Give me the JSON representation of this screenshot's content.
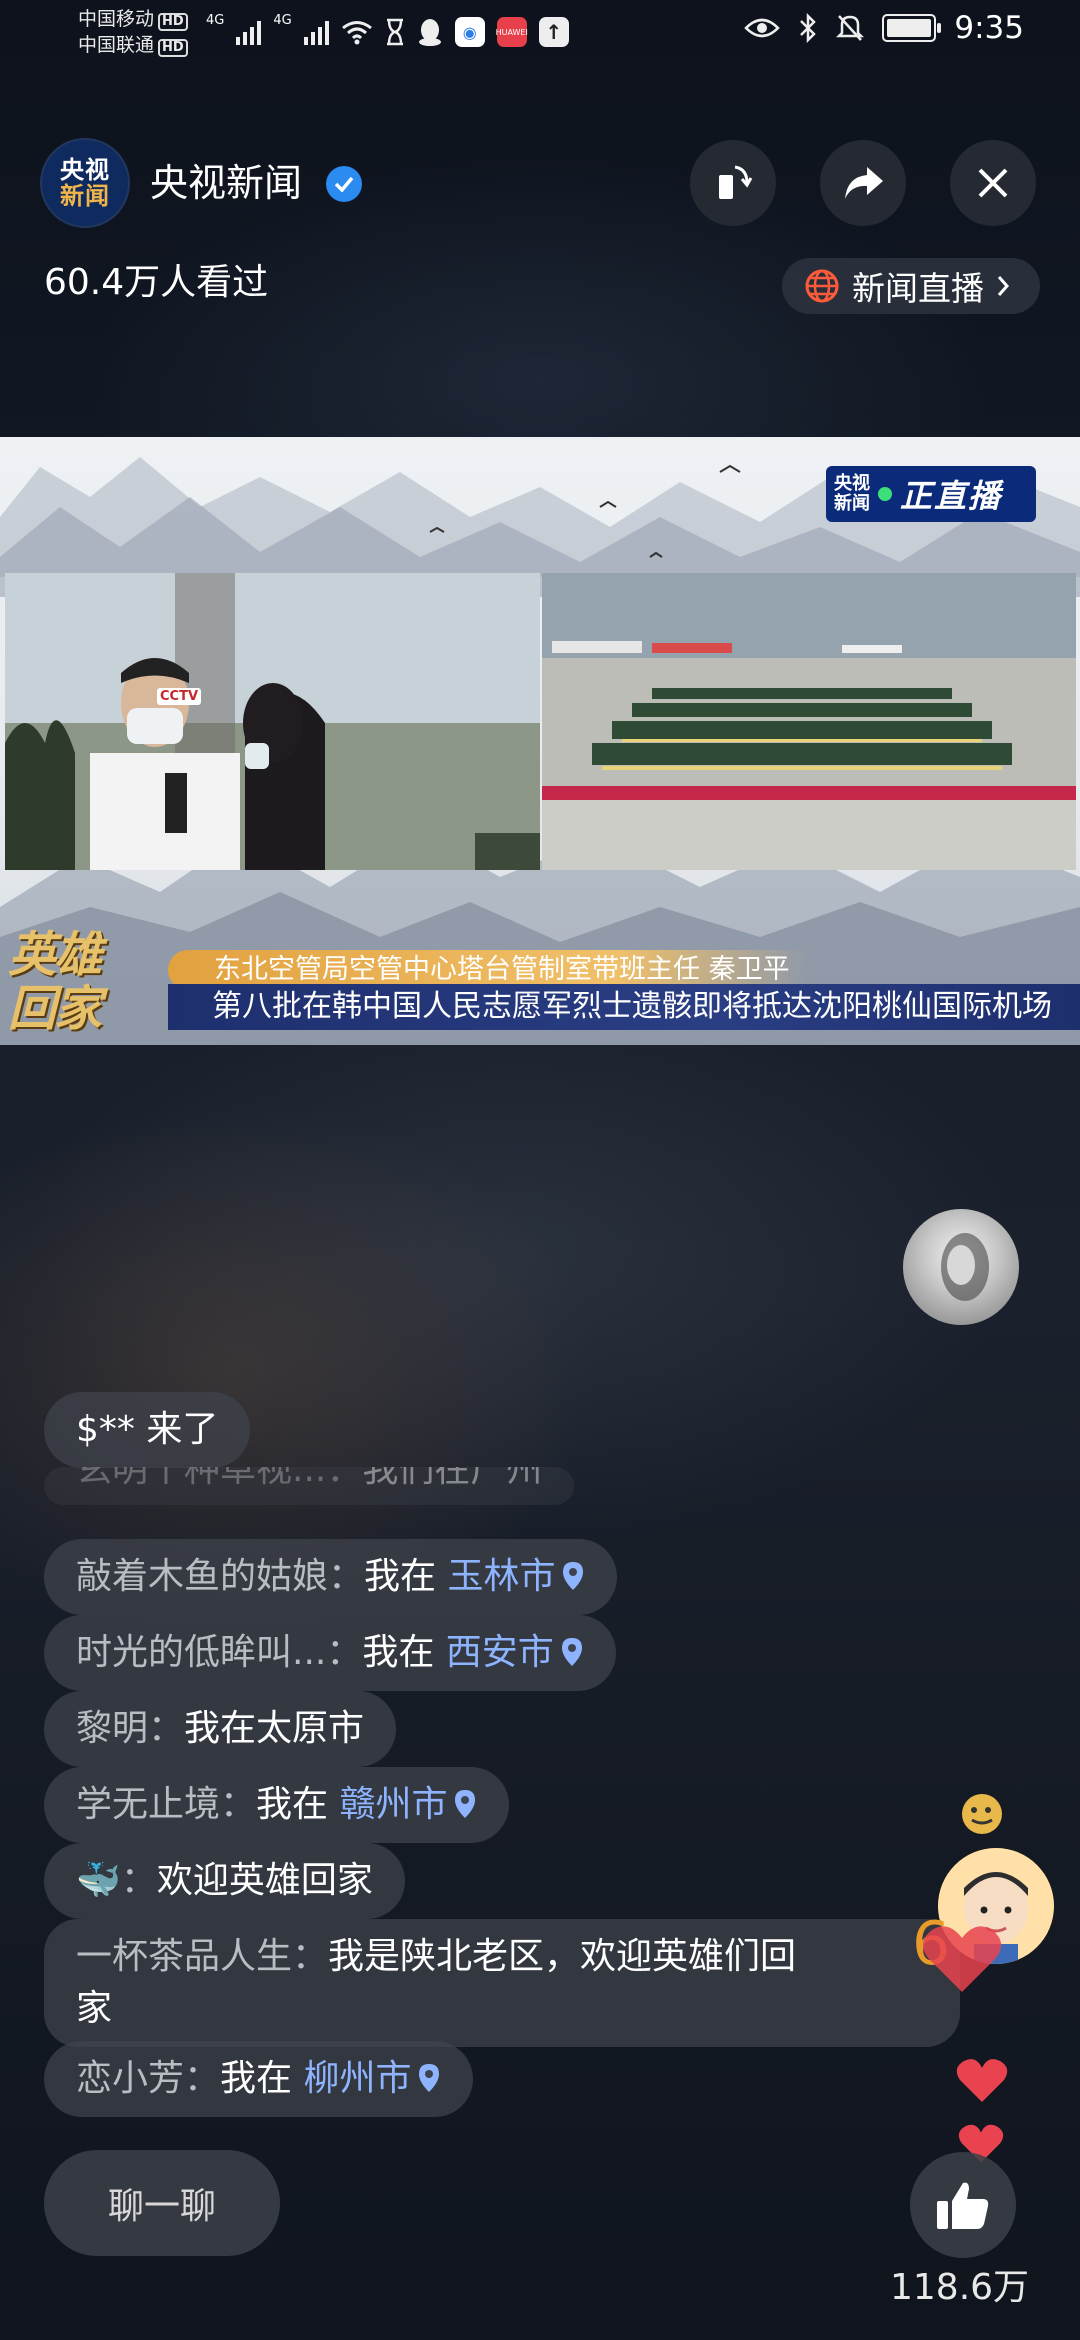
{
  "status_bar": {
    "carrier_1": "中国移动",
    "carrier_2": "中国联通",
    "hd": "HD",
    "network_1": "4G",
    "network_2": "4G",
    "time": "9:35",
    "icons": [
      "signal-icon",
      "wifi-icon",
      "hourglass-icon",
      "qq-icon",
      "browser-icon",
      "huawei-icon",
      "upload-icon",
      "eye-icon",
      "bluetooth-icon",
      "mute-icon",
      "battery-icon"
    ]
  },
  "header": {
    "channel_logo_line1": "央视",
    "channel_logo_line2": "新闻",
    "channel_name": "央视新闻",
    "viewer_count": "60.4万人看过",
    "live_tag": "新闻直播",
    "buttons": [
      "rotate-icon",
      "share-icon",
      "close-icon"
    ]
  },
  "video": {
    "badge_logo_line1": "央视",
    "badge_logo_line2": "新闻",
    "badge_text": "正直播",
    "cctv_mark": "CCTV",
    "hero_text_1": "英雄",
    "hero_text_2": "回家",
    "lower_third_name": "东北空管局空管中心塔台管制室带班主任 秦卫平",
    "lower_third_headline": "第八批在韩中国人民志愿军烈士遗骸即将抵达沈阳桃仙国际机场"
  },
  "chat": {
    "join_notice": "$** 来了",
    "faded_message": {
      "user": "玄明丨种草视...：",
      "text": "我们在广州"
    },
    "messages": [
      {
        "user": "敲着木鱼的姑娘：",
        "text": "我在 ",
        "location": "玉林市"
      },
      {
        "user": "时光的低眸叫...：",
        "text": "我在 ",
        "location": "西安市"
      },
      {
        "user": "黎明：",
        "text": "我在太原市",
        "location": ""
      },
      {
        "user": "学无止境：",
        "text": "我在 ",
        "location": "赣州市"
      },
      {
        "user": "🐳：",
        "text": "欢迎英雄回家",
        "location": ""
      },
      {
        "user": "一杯茶品人生：",
        "text": "我是陕北老区，欢迎英雄们回",
        "text_line2": "家",
        "location": ""
      },
      {
        "user": "恋小芳：",
        "text": "我在 ",
        "location": "柳州市"
      }
    ]
  },
  "footer": {
    "chat_button": "聊一聊",
    "like_count": "118.6万"
  },
  "colors": {
    "accent_blue": "#2b8bf0",
    "location_blue": "#8fb4ff",
    "heart_red": "#e9434f"
  }
}
